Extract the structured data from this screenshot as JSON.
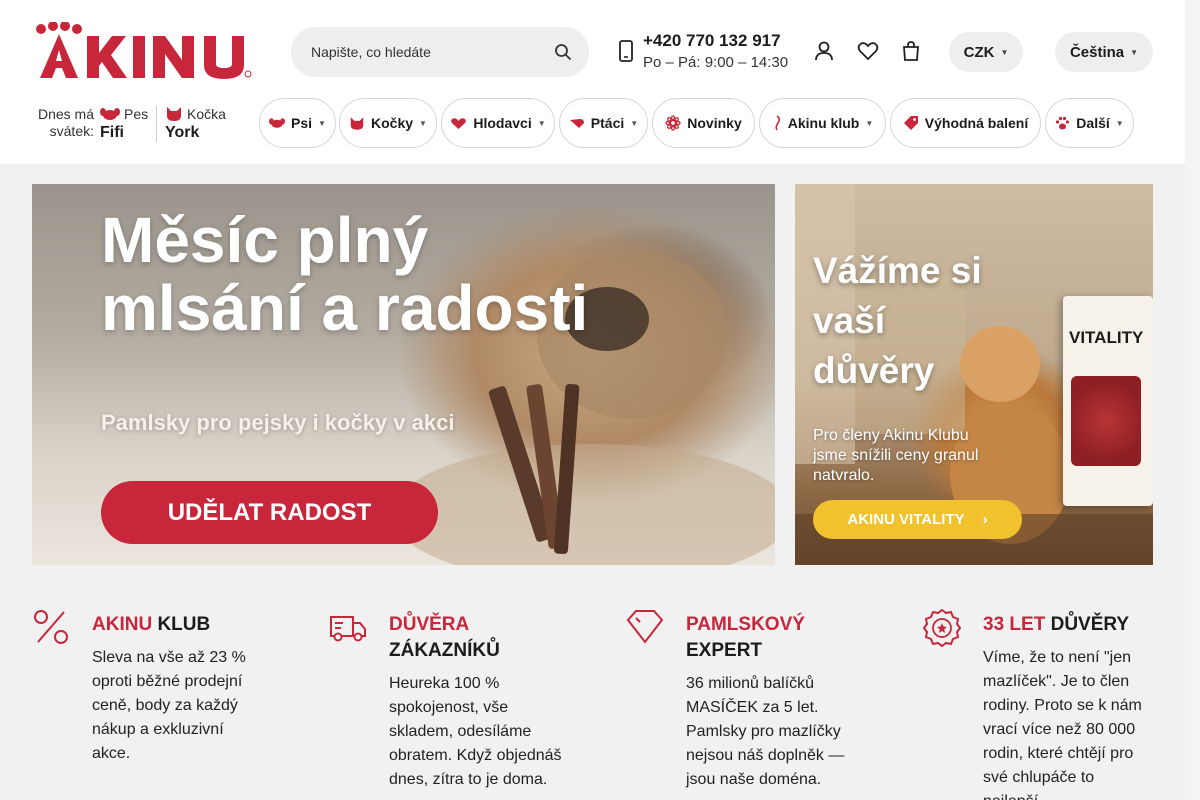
{
  "header": {
    "logo_text": "AKINU",
    "search": {
      "placeholder": "Napište, co hledáte"
    },
    "phone": "+420 770 132 917",
    "hours": "Po – Pá: 9:00 – 14:30",
    "currency": "CZK",
    "language": "Čeština",
    "icons": [
      "user-icon",
      "heart-icon",
      "cart-icon"
    ]
  },
  "nameday": {
    "label": "Dnes má svátek:",
    "dog": {
      "label": "Pes",
      "name": "Fifi"
    },
    "cat": {
      "label": "Kočka",
      "name": "York"
    }
  },
  "categories": [
    {
      "label": "Psi",
      "icon": "dog-icon"
    },
    {
      "label": "Kočky",
      "icon": "cat-icon"
    },
    {
      "label": "Hlodavci",
      "icon": "rodent-icon"
    },
    {
      "label": "Ptáci",
      "icon": "bird-icon"
    },
    {
      "label": "Novinky",
      "icon": "sparkle-icon"
    },
    {
      "label": "Akinu klub",
      "icon": "club-icon"
    },
    {
      "label": "Výhodná balení",
      "icon": "tag-icon"
    },
    {
      "label": "Další",
      "icon": "paw-icon"
    }
  ],
  "hero": {
    "title_line1": "Měsíc plný",
    "title_line2": "mlsání a radosti",
    "subtitle": "Pamlsky pro pejsky i kočky v akci",
    "cta": "UDĚLAT RADOST"
  },
  "side_banner": {
    "title_line1": "Vážíme si",
    "title_line2": "vaší",
    "title_line3": "důvěry",
    "text": "Pro členy Akinu Klubu jsme snížili ceny granul natvralo.",
    "cta": "AKINU VITALITY",
    "bag_brand": "VITALITY"
  },
  "features": [
    {
      "icon": "percent-icon",
      "title_red": "AKINU",
      "title_dark": "KLUB",
      "text": "Sleva na vše až 23 % oproti běžné prodejní ceně, body za každý nákup a exkluzivní akce."
    },
    {
      "icon": "truck-icon",
      "title_red": "DŮVĚRA",
      "title_dark": "ZÁKAZNÍKŮ",
      "text": "Heureka 100 % spokojenost, vše skladem, odesíláme obratem. Když objednáš dnes, zítra to je doma."
    },
    {
      "icon": "diamond-icon",
      "title_red": "PAMLSKOVÝ",
      "title_dark": "EXPERT",
      "text": "36 milionů balíčků MASÍČEK za 5 let. Pamlsky pro mazlíčky nejsou náš doplněk — jsou naše doména."
    },
    {
      "icon": "award-icon",
      "title_red": "33 LET",
      "title_dark": "DŮVĚRY",
      "text": "Víme, že to není \"jen mazlíček\". Je to člen rodiny. Proto se k nám vrací více než 80 000 rodin, které chtějí pro své chlupáče to nejlepší."
    }
  ],
  "colors": {
    "brand_red": "#c8263a",
    "accent_yellow": "#f2c12e"
  }
}
